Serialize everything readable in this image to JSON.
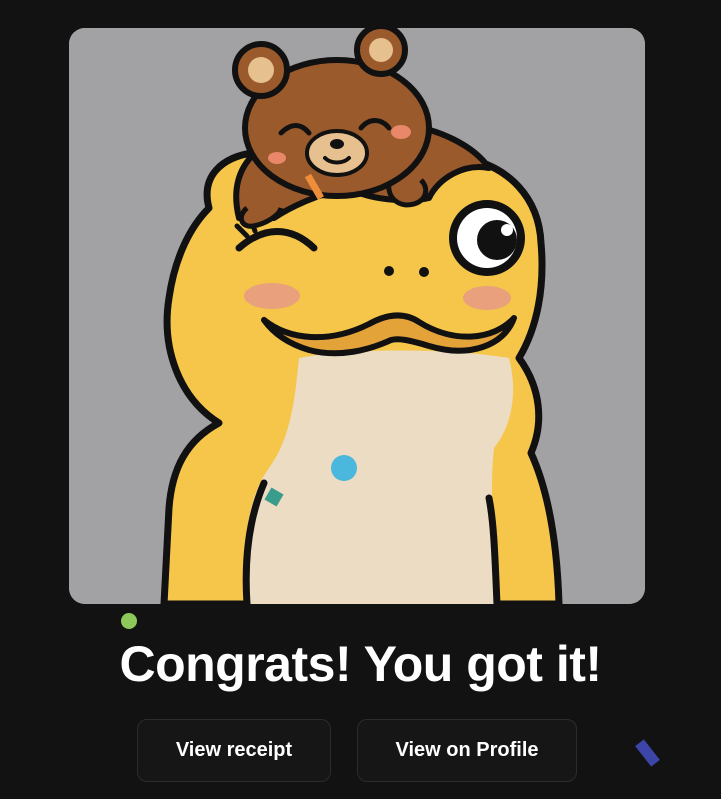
{
  "celebration": {
    "headline": "Congrats! You got it!"
  },
  "actions": {
    "view_receipt_label": "View receipt",
    "view_profile_label": "View on Profile"
  },
  "nft": {
    "subject": "yellow frog with mustache wearing a sleeping brown bear on its head",
    "background_color": "#a2a2a5"
  },
  "colors": {
    "page_background": "#121212",
    "button_background": "#161616",
    "text": "#ffffff",
    "frog_yellow": "#f6c64a",
    "mustache": "#e3a339",
    "bear_brown": "#9a5a2c"
  }
}
